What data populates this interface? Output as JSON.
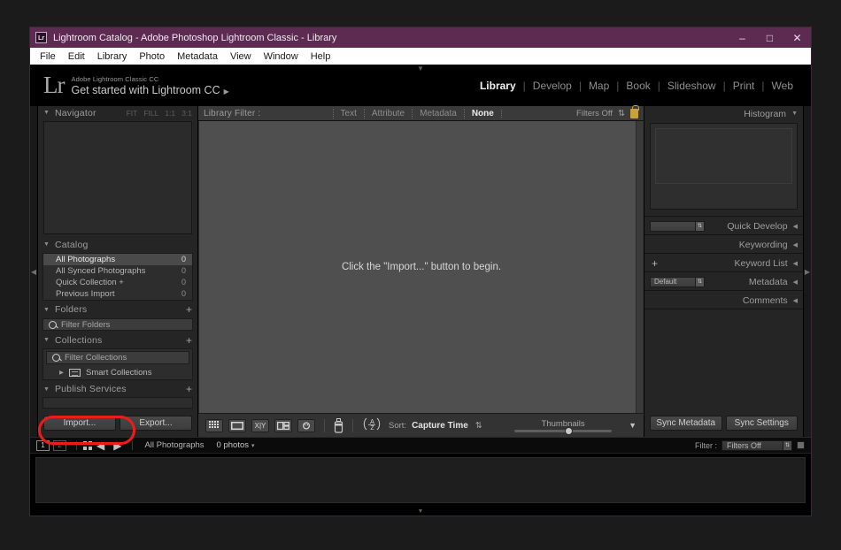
{
  "window": {
    "title": "Lightroom Catalog - Adobe Photoshop Lightroom Classic - Library",
    "badge": "Lr",
    "minimize": "–",
    "maximize": "□",
    "close": "✕",
    "titlebar_color": "#5d2a52"
  },
  "menubar": {
    "items": [
      "File",
      "Edit",
      "Library",
      "Photo",
      "Metadata",
      "View",
      "Window",
      "Help"
    ]
  },
  "identity": {
    "logo": "Lr",
    "line1": "Adobe Lightroom Classic CC",
    "line2": "Get started with Lightroom CC",
    "arrow": "▶",
    "top_caret": "▼"
  },
  "modules": {
    "items": [
      "Library",
      "Develop",
      "Map",
      "Book",
      "Slideshow",
      "Print",
      "Web"
    ],
    "active": "Library",
    "separator": "|"
  },
  "left_panel": {
    "collapse_arrow": "◀",
    "navigator": {
      "title": "Navigator",
      "triangle": "▼",
      "zoom_options": [
        "FIT",
        "FILL",
        "1:1",
        "3:1"
      ]
    },
    "catalog": {
      "title": "Catalog",
      "triangle": "▼",
      "rows": [
        {
          "label": "All Photographs",
          "count": "0",
          "selected": true
        },
        {
          "label": "All Synced Photographs",
          "count": "0",
          "selected": false
        },
        {
          "label": "Quick Collection  +",
          "count": "0",
          "selected": false
        },
        {
          "label": "Previous Import",
          "count": "0",
          "selected": false
        }
      ]
    },
    "folders": {
      "title": "Folders",
      "triangle": "▼",
      "plus": "+",
      "filter_placeholder": "Filter Folders"
    },
    "collections": {
      "title": "Collections",
      "triangle": "▼",
      "plus": "+",
      "filter_placeholder": "Filter Collections",
      "smart_collections": "Smart Collections",
      "smart_triangle": "▶"
    },
    "publish_services": {
      "title": "Publish Services",
      "triangle": "▼",
      "plus": "+"
    },
    "buttons": {
      "import": "Import...",
      "export": "Export..."
    }
  },
  "library_filter": {
    "label": "Library Filter :",
    "items": [
      "Text",
      "Attribute",
      "Metadata",
      "None"
    ],
    "active": "None",
    "filters_off": "Filters Off",
    "stepper": "⇅",
    "lock_icon": "lock-icon"
  },
  "content": {
    "message": "Click the \"Import...\" button to begin."
  },
  "toolbar": {
    "view_icons": [
      "grid-view-icon",
      "loupe-view-icon",
      "compare-view-icon",
      "survey-view-icon",
      "people-view-icon"
    ],
    "compare_label": "X|Y",
    "people_label": "☺",
    "painter_icon": "painter-spray-icon",
    "sort_icon": "a-z-sort-icon",
    "sort_icon_label": "A\nZ",
    "sort_label": "Sort:",
    "sort_value": "Capture Time",
    "sort_stepper": "⇅",
    "thumbnails_label": "Thumbnails",
    "panel_caret": "▼"
  },
  "right_panel": {
    "collapse_arrow": "▶",
    "histogram": {
      "title": "Histogram",
      "triangle": "▼"
    },
    "quick_develop": {
      "title": "Quick Develop",
      "triangle": "◀",
      "preset_value": ""
    },
    "keywording": {
      "title": "Keywording",
      "triangle": "◀"
    },
    "keyword_list": {
      "title": "Keyword List",
      "triangle": "◀",
      "plus": "+"
    },
    "metadata": {
      "title": "Metadata",
      "triangle": "◀",
      "preset_value": "Default"
    },
    "comments": {
      "title": "Comments",
      "triangle": "◀"
    },
    "buttons": {
      "sync_metadata": "Sync Metadata",
      "sync_settings": "Sync Settings"
    }
  },
  "filmstrip": {
    "screen1": "1",
    "screen2": "2",
    "grid_icon": "grid-icon",
    "back_arrow": "◀",
    "forward_arrow": "▶",
    "source": "All Photographs",
    "photo_count": "0 photos",
    "count_caret": "▾",
    "filter_label": "Filter :",
    "filter_value": "Filters Off",
    "filter_stepper": "⇅",
    "bottom_caret": "▼"
  }
}
